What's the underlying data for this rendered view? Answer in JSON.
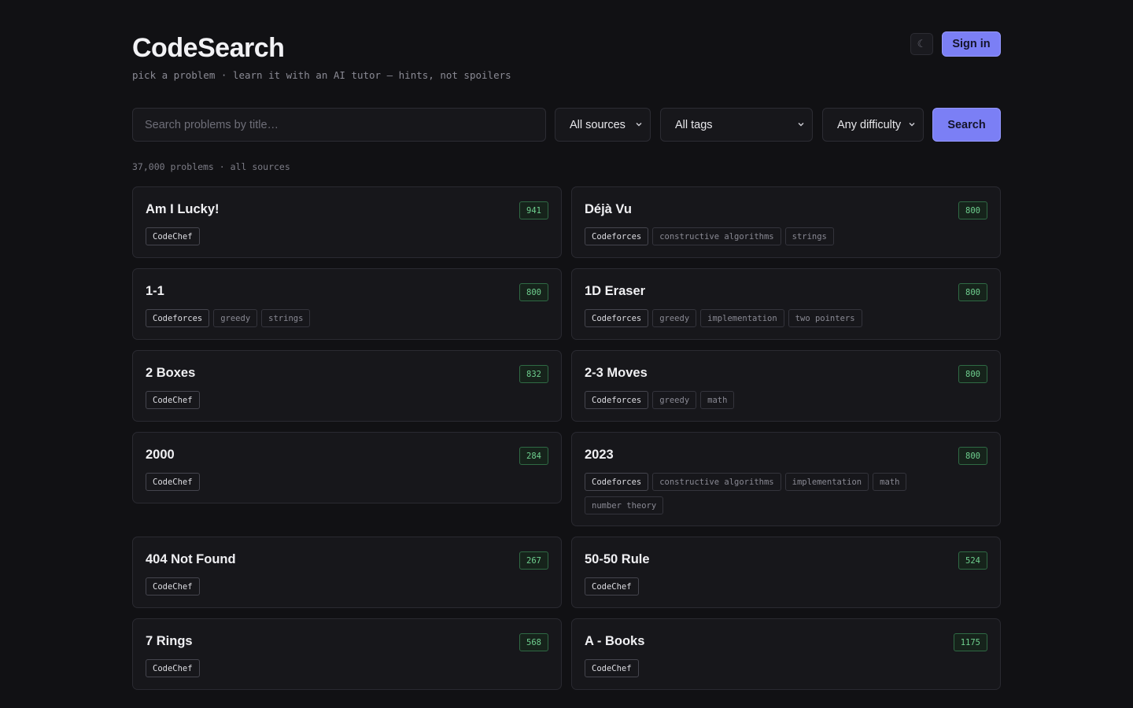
{
  "header": {
    "title": "CodeSearch",
    "tagline": "pick a problem · learn it with an AI tutor — hints, not spoilers",
    "theme_toggle": "☾",
    "signin_label": "Sign in"
  },
  "filters": {
    "search_placeholder": "Search problems by title…",
    "source": "All sources",
    "tags": "All tags",
    "difficulty": "Any difficulty",
    "search_label": "Search"
  },
  "results_summary": "37,000 problems · all sources",
  "problems": [
    {
      "title": "Am I Lucky!",
      "rating": "941",
      "source": "CodeChef",
      "tags": []
    },
    {
      "title": "Déjà Vu",
      "rating": "800",
      "source": "Codeforces",
      "tags": [
        "constructive algorithms",
        "strings"
      ]
    },
    {
      "title": "1-1",
      "rating": "800",
      "source": "Codeforces",
      "tags": [
        "greedy",
        "strings"
      ]
    },
    {
      "title": "1D Eraser",
      "rating": "800",
      "source": "Codeforces",
      "tags": [
        "greedy",
        "implementation",
        "two pointers"
      ]
    },
    {
      "title": "2 Boxes",
      "rating": "832",
      "source": "CodeChef",
      "tags": []
    },
    {
      "title": "2-3 Moves",
      "rating": "800",
      "source": "Codeforces",
      "tags": [
        "greedy",
        "math"
      ]
    },
    {
      "title": "2000",
      "rating": "284",
      "source": "CodeChef",
      "tags": []
    },
    {
      "title": "2023",
      "rating": "800",
      "source": "Codeforces",
      "tags": [
        "constructive algorithms",
        "implementation",
        "math",
        "number theory"
      ]
    },
    {
      "title": "404 Not Found",
      "rating": "267",
      "source": "CodeChef",
      "tags": []
    },
    {
      "title": "50-50 Rule",
      "rating": "524",
      "source": "CodeChef",
      "tags": []
    },
    {
      "title": "7 Rings",
      "rating": "568",
      "source": "CodeChef",
      "tags": []
    },
    {
      "title": "A - Books",
      "rating": "1175",
      "source": "CodeChef",
      "tags": []
    }
  ],
  "colors": {
    "background": "#111114",
    "card": "#17171b",
    "accent": "#7b7ff5",
    "rating_green": "#6fd08f"
  }
}
